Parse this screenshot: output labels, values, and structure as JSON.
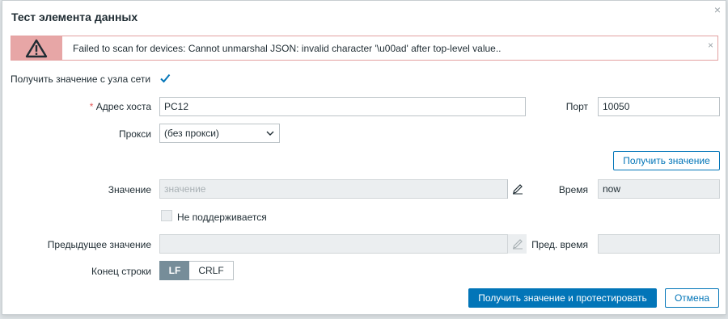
{
  "dialog": {
    "title": "Тест элемента данных",
    "close_glyph": "×"
  },
  "alert": {
    "message": "Failed to scan for devices: Cannot unmarshal JSON: invalid character '\\u00ad' after top-level value..",
    "close_glyph": "×",
    "icon": "warning-triangle-icon",
    "accent_color": "#e7a6a6"
  },
  "form": {
    "get_from_host_label": "Получить значение с узла сети",
    "get_from_host_checked": true,
    "required_mark": "*",
    "host_address_label": "Адрес хоста",
    "host_address_value": "PC12",
    "port_label": "Порт",
    "port_value": "10050",
    "proxy_label": "Прокси",
    "proxy_value": "(без прокси)",
    "get_value_button": "Получить значение",
    "value_label": "Значение",
    "value_placeholder": "значение",
    "time_label": "Время",
    "time_value": "now",
    "not_supported_label": "Не поддерживается",
    "not_supported_checked": false,
    "prev_value_label": "Предыдущее значение",
    "prev_value": "",
    "prev_time_label": "Пред. время",
    "prev_time_value": "",
    "eol_label": "Конец строки",
    "eol_options": [
      "LF",
      "CRLF"
    ],
    "eol_selected": "LF"
  },
  "footer": {
    "test_button": "Получить значение и протестировать",
    "cancel_button": "Отмена"
  },
  "colors": {
    "primary": "#0275b8",
    "segment_active": "#768d99",
    "required": "#e45959"
  }
}
